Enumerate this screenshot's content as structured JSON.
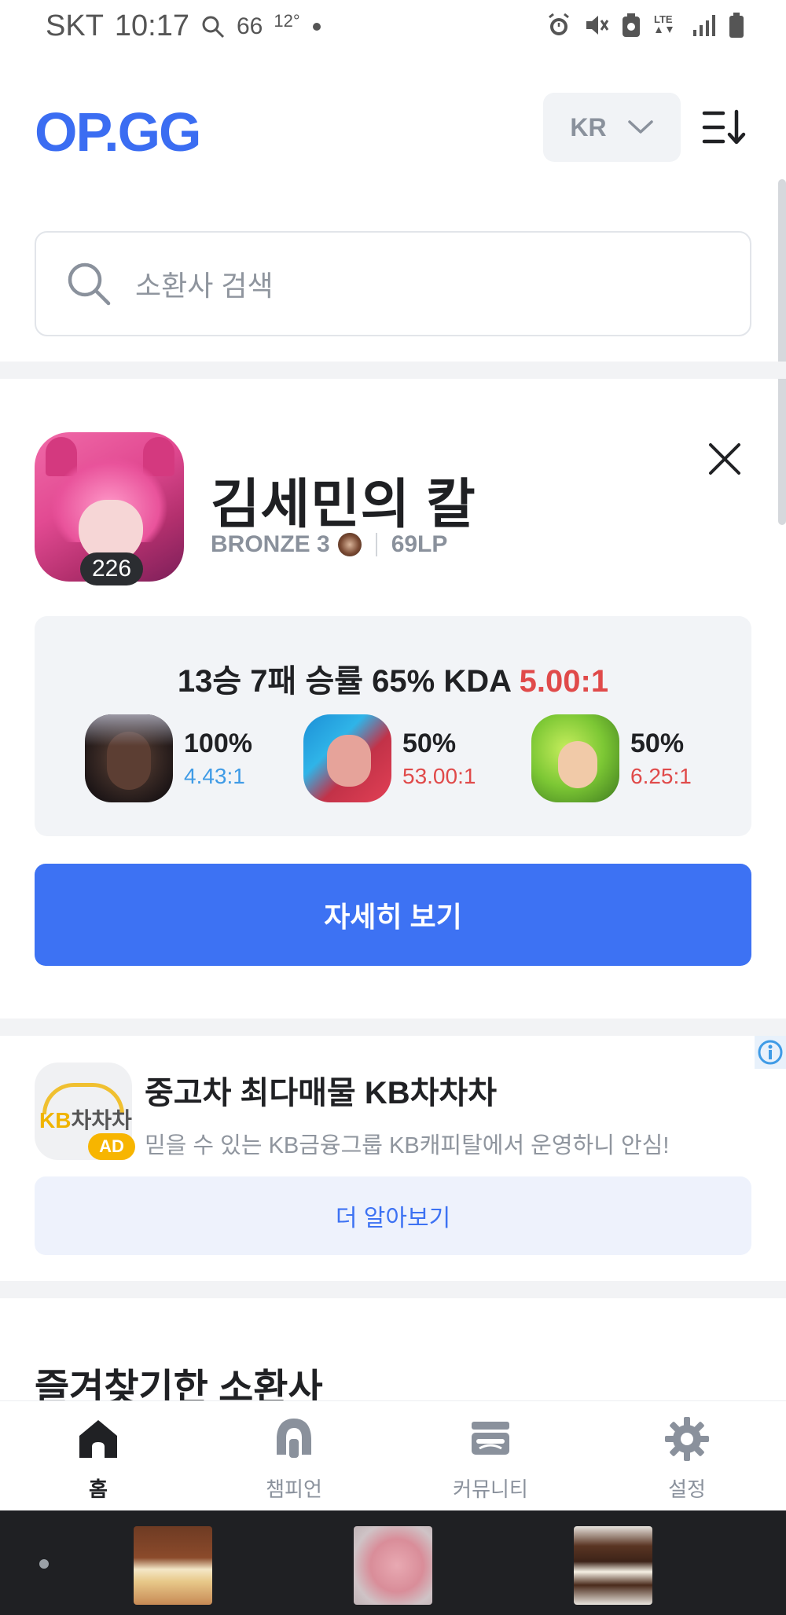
{
  "status_bar": {
    "carrier": "SKT",
    "time": "10:17",
    "notification_count": "66",
    "temperature": "12°",
    "network": "LTE"
  },
  "header": {
    "logo": "OP.GG",
    "region": "KR"
  },
  "search": {
    "placeholder": "소환사 검색"
  },
  "profile": {
    "name": "김세민의 칼",
    "level": "226",
    "rank": "BRONZE 3",
    "lp": "69LP"
  },
  "stats": {
    "record": "13승 7패 승률 65% KDA ",
    "kda": "5.00:1",
    "champions": [
      {
        "win_rate": "100%",
        "kda": "4.43:1",
        "kda_color": "#3f9be6"
      },
      {
        "win_rate": "50%",
        "kda": "53.00:1",
        "kda_color": "#e04a4a"
      },
      {
        "win_rate": "50%",
        "kda": "6.25:1",
        "kda_color": "#e04a4a"
      }
    ]
  },
  "detail_button": "자세히 보기",
  "ad": {
    "logo_text_kb": "KB",
    "logo_text_rest": "차차차",
    "badge": "AD",
    "title": "중고차 최다매물 KB차차차",
    "description": "믿을 수 있는 KB금융그룹 KB캐피탈에서 운영하니 안심!",
    "cta": "더 알아보기"
  },
  "favorites": {
    "title": "즐겨찾기한 소환사"
  },
  "bottom_nav": [
    {
      "label": "홈",
      "icon": "home-icon",
      "active": true
    },
    {
      "label": "챔피언",
      "icon": "champion-icon",
      "active": false
    },
    {
      "label": "커뮤니티",
      "icon": "community-icon",
      "active": false
    },
    {
      "label": "설정",
      "icon": "settings-icon",
      "active": false
    }
  ],
  "colors": {
    "brand": "#3b6df2",
    "button": "#3d72f3",
    "kda_red": "#e04a4a",
    "kda_blue": "#3f9be6"
  }
}
